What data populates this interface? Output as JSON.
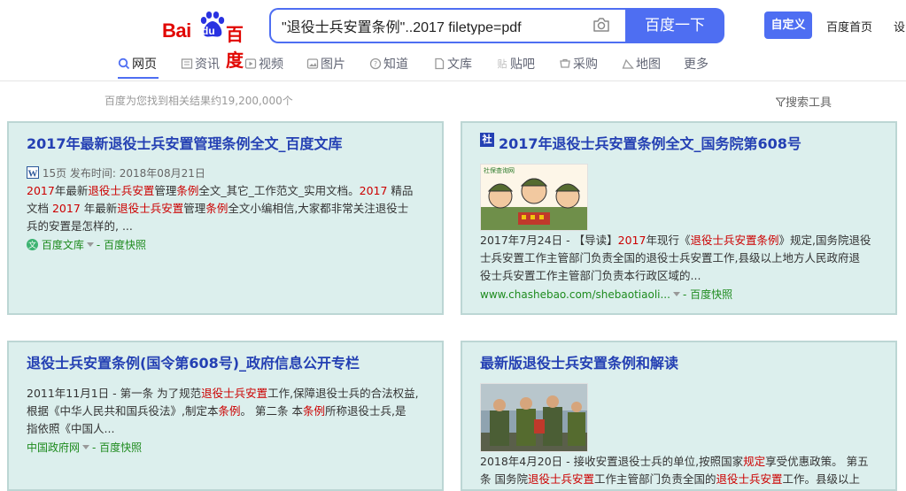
{
  "header": {
    "logo_bai": "Bai",
    "logo_du": "du",
    "logo_baidu": "百度",
    "search_query": "\"退役士兵安置条例\"..2017 filetype=pdf",
    "search_button": "百度一下",
    "custom_button": "自定义",
    "home_link": "百度首页",
    "settings_link": "设"
  },
  "tabs": [
    {
      "label": "网页",
      "icon": "search-icon"
    },
    {
      "label": "资讯",
      "icon": "news-icon"
    },
    {
      "label": "视频",
      "icon": "video-icon"
    },
    {
      "label": "图片",
      "icon": "image-icon"
    },
    {
      "label": "知道",
      "icon": "question-icon"
    },
    {
      "label": "文库",
      "icon": "doc-icon"
    },
    {
      "label": "贴吧",
      "icon": "tieba-icon"
    },
    {
      "label": "采购",
      "icon": "cart-icon"
    },
    {
      "label": "地图",
      "icon": "map-icon"
    },
    {
      "label": "更多",
      "icon": ""
    }
  ],
  "result_count": "百度为您找到相关结果约19,200,000个",
  "search_tools": "搜索工具",
  "results": [
    {
      "title": "2017年最新退役士兵安置管理条例全文_百度文库",
      "meta": "15页 发布时间: 2018年08月21日",
      "snippet_lines": [
        "2017年最新退役士兵安置管理条例全文_其它_工作范文_实用文档。2017 精品",
        "文档 2017 年最新退役士兵安置管理条例全文小编相信,大家都非常关注退役士",
        "兵的安置是怎样的, ..."
      ],
      "source": "百度文库",
      "cache": "百度快照"
    },
    {
      "title": "2017年退役士兵安置条例全文_国务院第608号",
      "badge": "社",
      "thumb_label": "社保查询网",
      "snippet_lines": [
        "2017年7月24日 - 【导读】2017年现行《退役士兵安置条例》规定,国务院退役",
        "士兵安置工作主管部门负责全国的退役士兵安置工作,县级以上地方人民政府退",
        "役士兵安置工作主管部门负责本行政区域的..."
      ],
      "source": "www.chashebao.com/shebaotiaoli...",
      "cache": "百度快照"
    },
    {
      "title": "退役士兵安置条例(国令第608号)_政府信息公开专栏",
      "snippet_lines": [
        "2011年11月1日 - 第一条 为了规范退役士兵安置工作,保障退役士兵的合法权益,",
        "根据《中华人民共和国兵役法》,制定本条例。 第二条 本条例所称退役士兵,是",
        "指依照《中国人..."
      ],
      "source": "中国政府网",
      "cache": "百度快照"
    },
    {
      "title": "最新版退役士兵安置条例和解读",
      "snippet_lines": [
        "2018年4月20日 - 接收安置退役士兵的单位,按照国家规定享受优惠政策。 第五",
        "条 国务院退役士兵安置工作主管部门负责全国的退役士兵安置工作。县级以上"
      ]
    }
  ],
  "colors": {
    "accent": "#4e6ef2",
    "card_bg": "#dcefed",
    "title": "#2440b3",
    "highlight": "#c00000",
    "source": "#1e8b1e"
  }
}
